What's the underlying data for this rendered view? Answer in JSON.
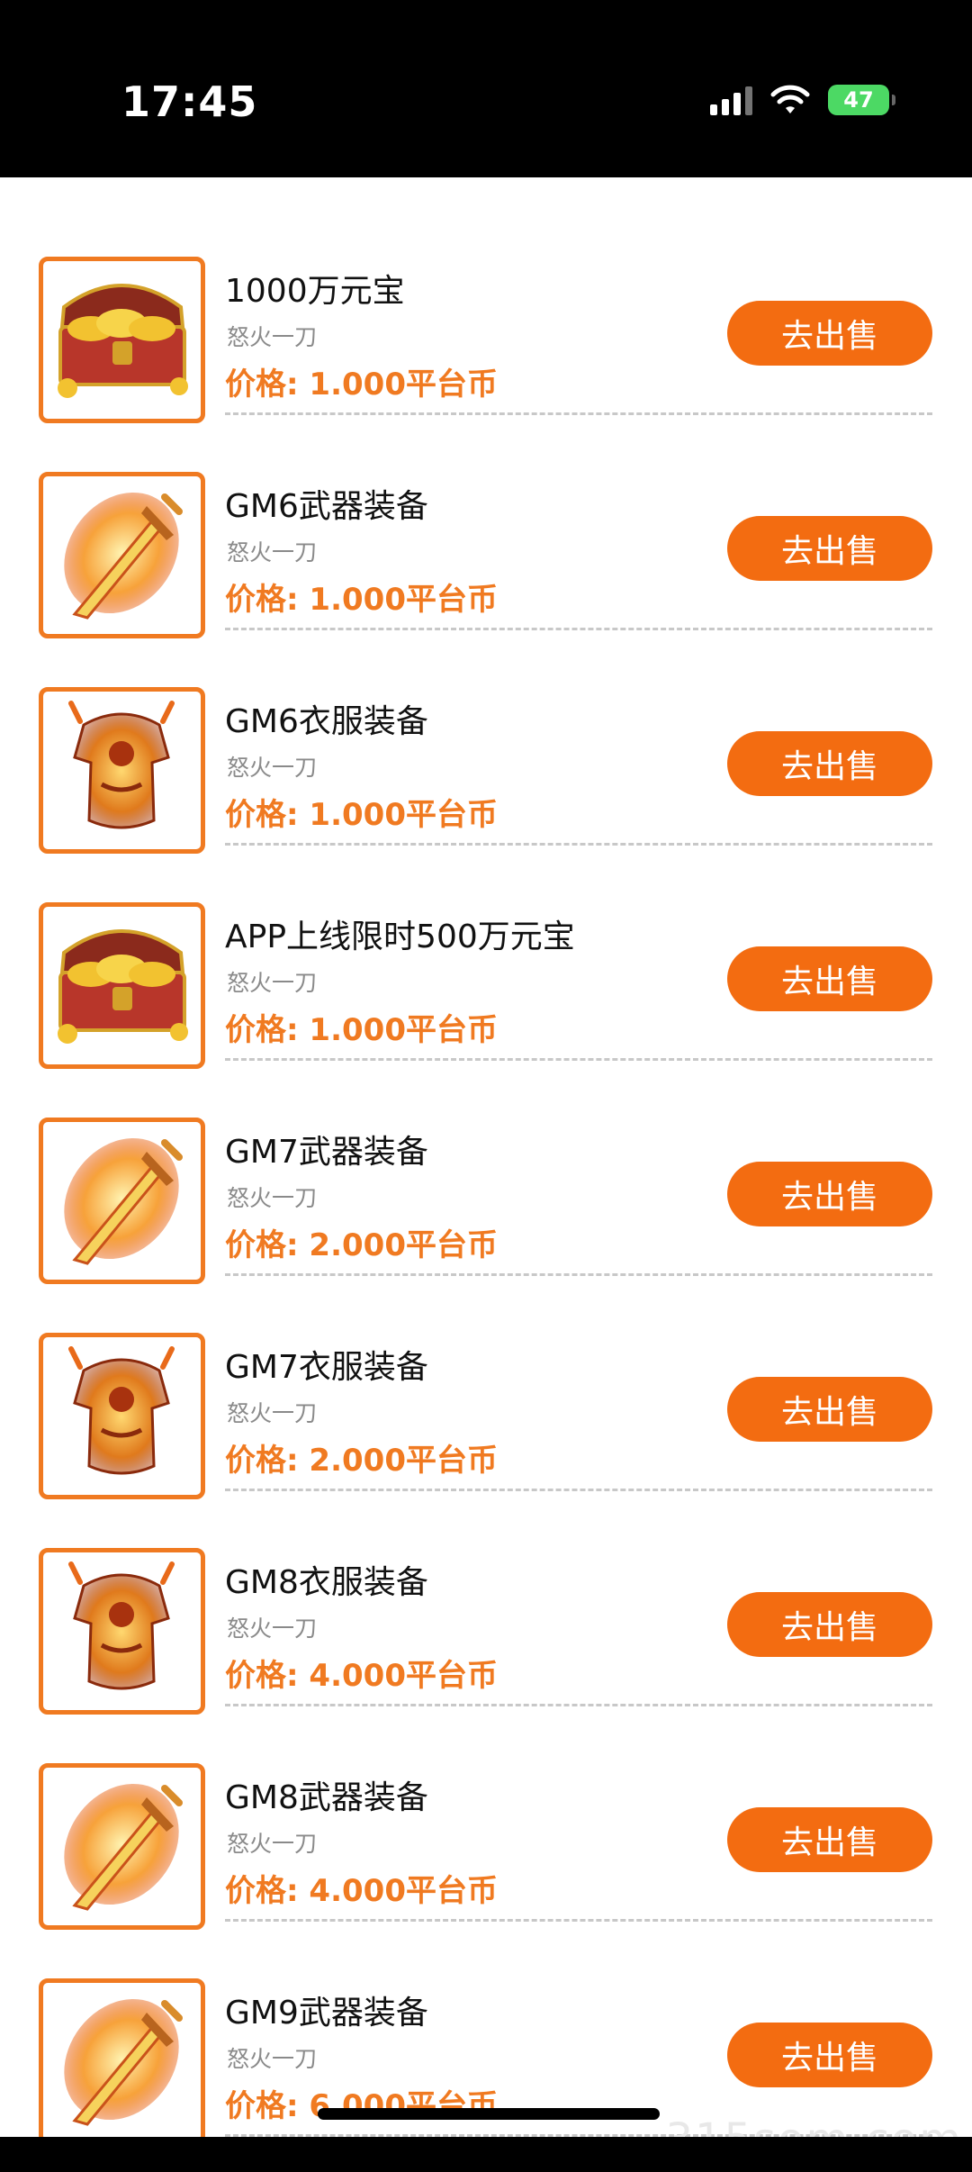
{
  "status_bar": {
    "time": "17:45",
    "battery": "47"
  },
  "items": [
    {
      "title": "1000万元宝",
      "seller": "怒火一刀",
      "price": "价格: 1.000平台币",
      "button": "去出售",
      "icon": "treasure-chest-icon"
    },
    {
      "title": "GM6武器装备",
      "seller": "怒火一刀",
      "price": "价格: 1.000平台币",
      "button": "去出售",
      "icon": "flame-sword-icon"
    },
    {
      "title": "GM6衣服装备",
      "seller": "怒火一刀",
      "price": "价格: 1.000平台币",
      "button": "去出售",
      "icon": "flame-armor-icon"
    },
    {
      "title": "APP上线限时500万元宝",
      "seller": "怒火一刀",
      "price": "价格: 1.000平台币",
      "button": "去出售",
      "icon": "treasure-chest-icon"
    },
    {
      "title": "GM7武器装备",
      "seller": "怒火一刀",
      "price": "价格: 2.000平台币",
      "button": "去出售",
      "icon": "flame-sword-icon"
    },
    {
      "title": "GM7衣服装备",
      "seller": "怒火一刀",
      "price": "价格: 2.000平台币",
      "button": "去出售",
      "icon": "flame-armor-icon"
    },
    {
      "title": "GM8衣服装备",
      "seller": "怒火一刀",
      "price": "价格: 4.000平台币",
      "button": "去出售",
      "icon": "flame-armor-icon"
    },
    {
      "title": "GM8武器装备",
      "seller": "怒火一刀",
      "price": "价格: 4.000平台币",
      "button": "去出售",
      "icon": "flame-sword-icon"
    },
    {
      "title": "GM9武器装备",
      "seller": "怒火一刀",
      "price": "价格: 6.000平台币",
      "button": "去出售",
      "icon": "flame-sword-icon"
    }
  ],
  "watermark": "315som.com",
  "colors": {
    "accent": "#f36c11",
    "price": "#f07a21",
    "border": "#f07a21"
  }
}
